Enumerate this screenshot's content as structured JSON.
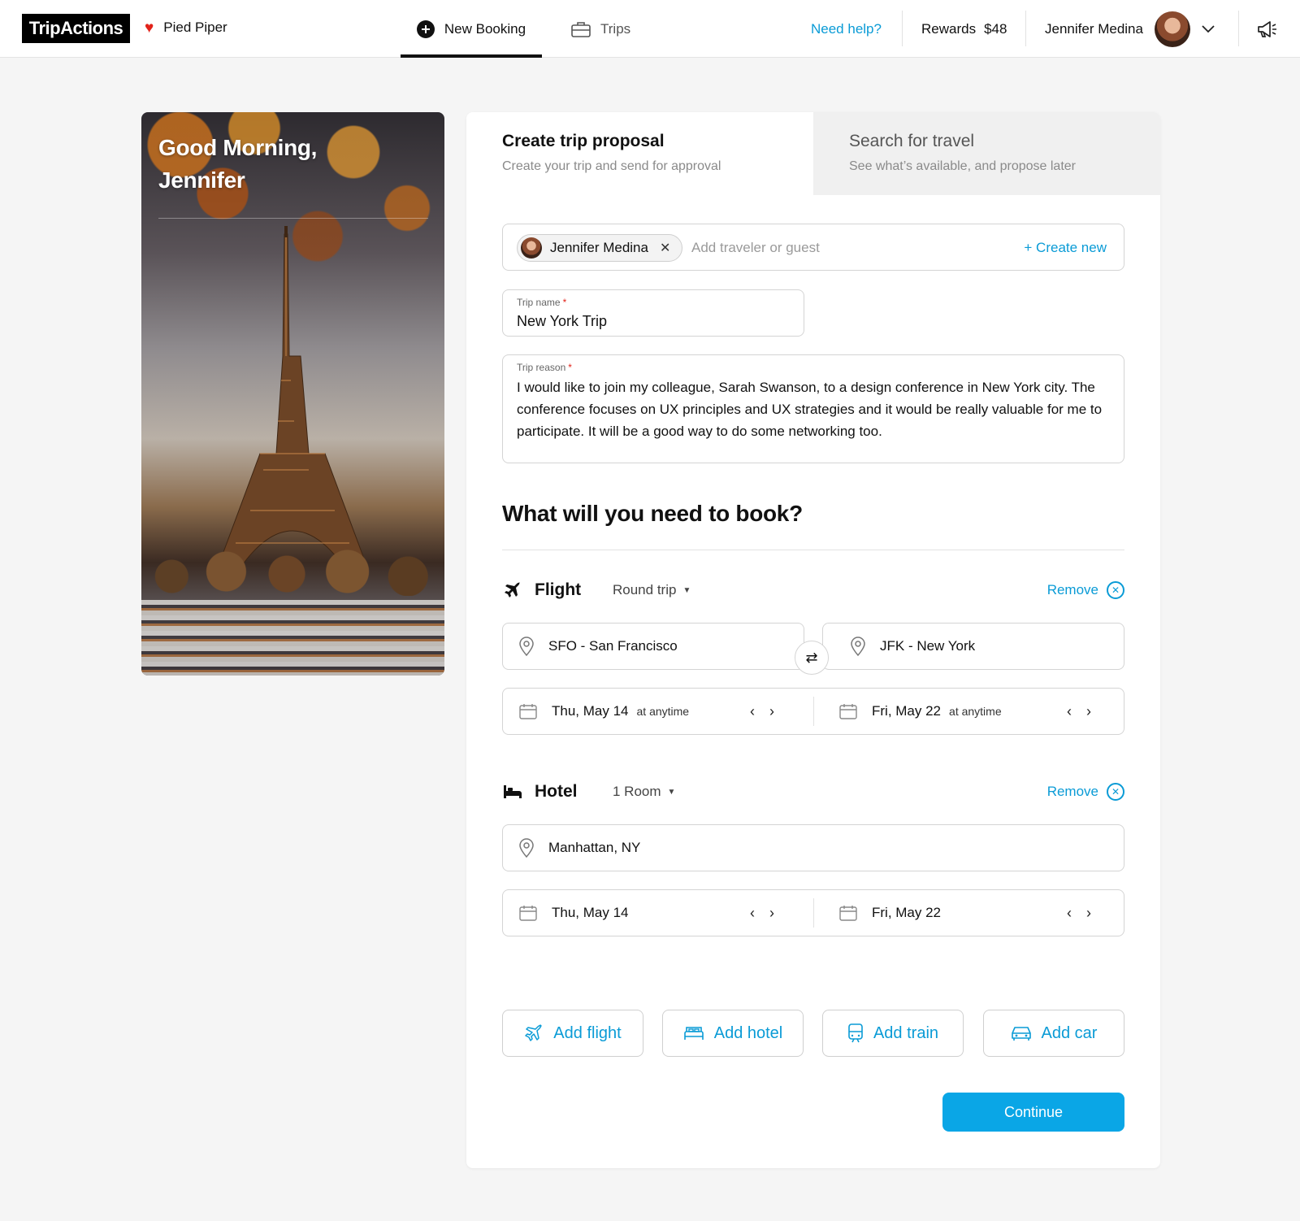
{
  "header": {
    "logo": "TripActions",
    "company": "Pied Piper",
    "tabs": {
      "new_booking": "New Booking",
      "trips": "Trips"
    },
    "help": "Need help?",
    "rewards_label": "Rewards",
    "rewards_value": "$48",
    "user_name": "Jennifer Medina"
  },
  "hero": {
    "greeting_line1": "Good Morning,",
    "greeting_line2": "Jennifer"
  },
  "mode_tabs": [
    {
      "title": "Create trip proposal",
      "subtitle": "Create your trip and send for approval",
      "active": true
    },
    {
      "title": "Search for travel",
      "subtitle": "See what’s available, and propose later",
      "active": false
    }
  ],
  "travelers": {
    "chip": "Jennifer Medina",
    "placeholder": "Add traveler or guest",
    "create_new": "+ Create new"
  },
  "trip_name": {
    "label": "Trip name",
    "value": "New York Trip"
  },
  "trip_reason": {
    "label": "Trip reason",
    "value": "I would like to join my colleague, Sarah Swanson, to a design conference in New York city. The conference focuses on UX principles and UX  strategies and it would be really valuable for me to participate. It will be a good way to do some networking too."
  },
  "section_title": "What will you need to book?",
  "flight": {
    "title": "Flight",
    "trip_type": "Round trip",
    "remove": "Remove",
    "origin": "SFO - San Francisco",
    "destination": "JFK - New York",
    "depart_date": "Thu, May 14",
    "depart_time": "at anytime",
    "return_date": "Fri, May 22",
    "return_time": "at anytime"
  },
  "hotel": {
    "title": "Hotel",
    "rooms": "1 Room",
    "remove": "Remove",
    "location": "Manhattan, NY",
    "checkin": "Thu, May 14",
    "checkout": "Fri, May 22"
  },
  "add_buttons": {
    "flight": "Add flight",
    "hotel": "Add hotel",
    "train": "Add train",
    "car": "Add car"
  },
  "continue": "Continue",
  "colors": {
    "accent": "#0a9bd6",
    "primary_button": "#0aa6e6",
    "required": "#e2231a"
  }
}
